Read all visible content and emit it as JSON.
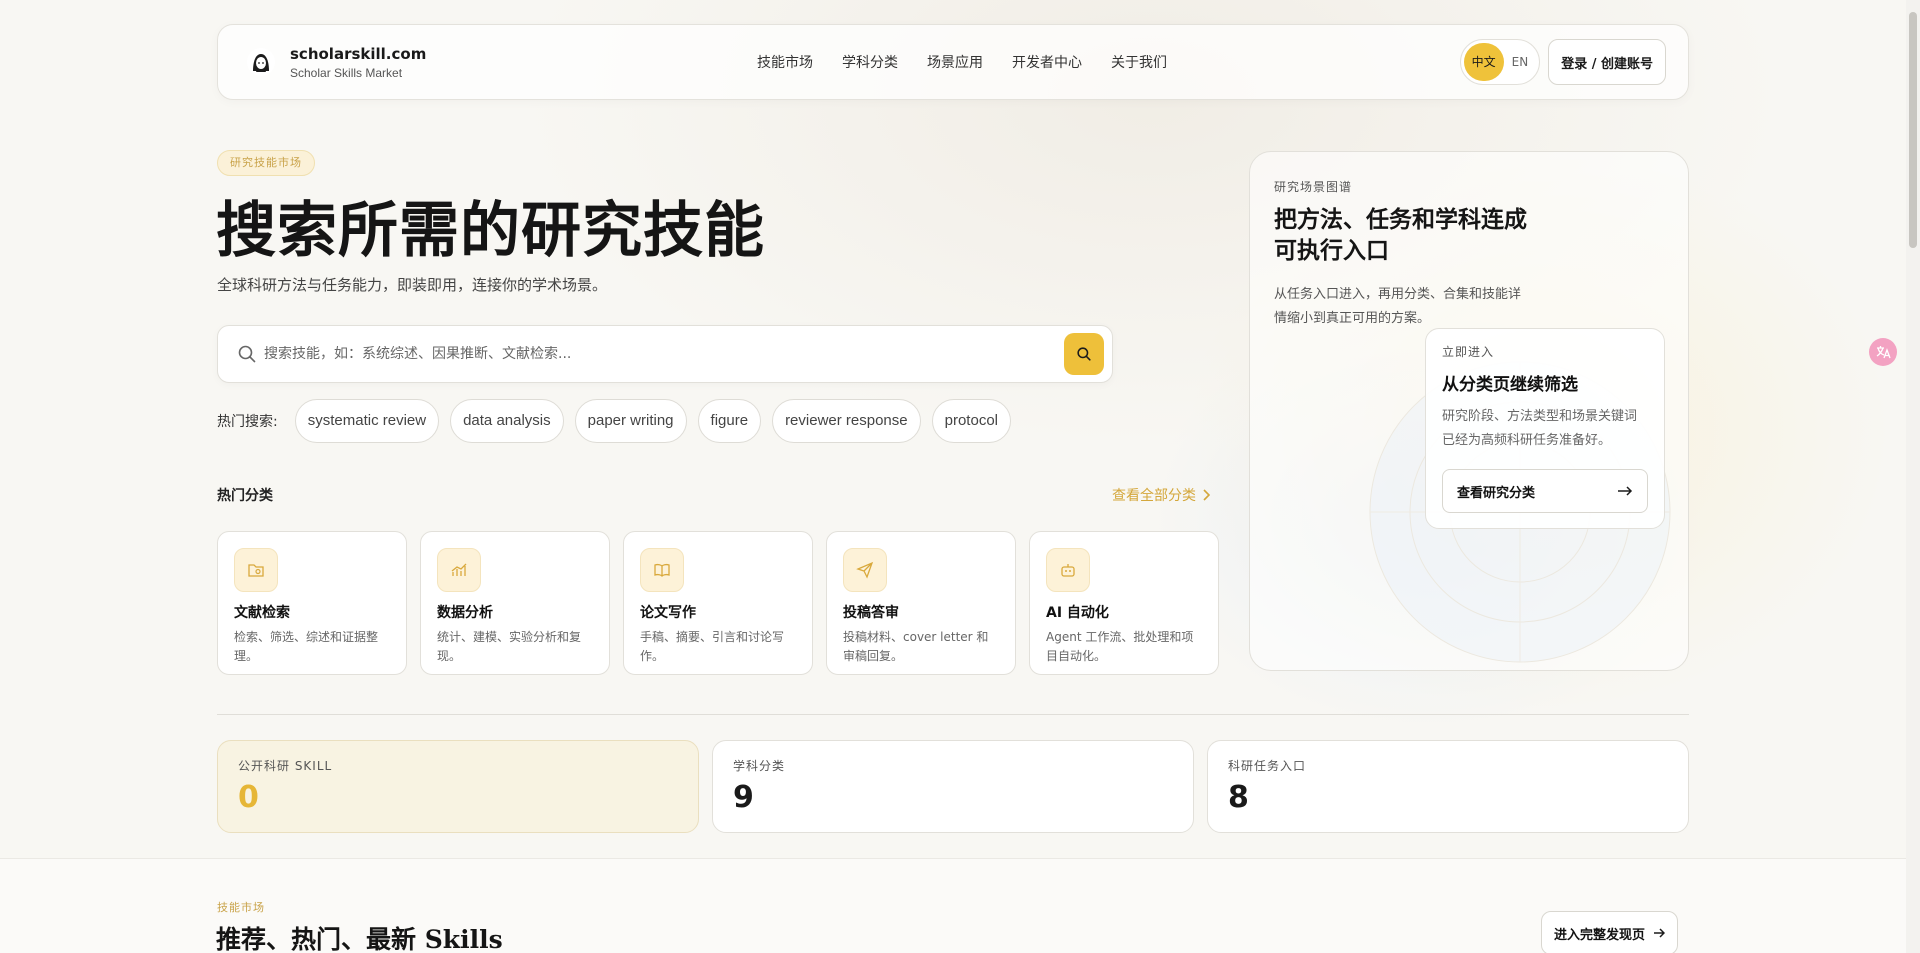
{
  "brand": {
    "name": "scholarskill.com",
    "subtitle": "Scholar Skills Market"
  },
  "nav": {
    "items": [
      "技能市场",
      "学科分类",
      "场景应用",
      "开发者中心",
      "关于我们"
    ]
  },
  "lang": {
    "zh": "中文",
    "en": "EN"
  },
  "header": {
    "login_label": "登录 / 创建账号"
  },
  "hero": {
    "pill": "研究技能市场",
    "title": "搜索所需的研究技能",
    "subtitle": "全球科研方法与任务能力，即装即用，连接你的学术场景。"
  },
  "search": {
    "placeholder": "搜索技能，如：系统综述、因果推断、文献检索..."
  },
  "hot": {
    "label": "热门搜索:",
    "tags": [
      "systematic review",
      "data analysis",
      "paper writing",
      "figure",
      "reviewer response",
      "protocol"
    ]
  },
  "categories": {
    "section_label": "热门分类",
    "see_all": "查看全部分类",
    "items": [
      {
        "title": "文献检索",
        "desc": "检索、筛选、综述和证据整理。"
      },
      {
        "title": "数据分析",
        "desc": "统计、建模、实验分析和复现。"
      },
      {
        "title": "论文写作",
        "desc": "手稿、摘要、引言和讨论写作。"
      },
      {
        "title": "投稿答审",
        "desc": "投稿材料、cover letter 和审稿回复。"
      },
      {
        "title": "AI 自动化",
        "desc": "Agent 工作流、批处理和项目自动化。"
      }
    ]
  },
  "panel": {
    "tag": "研究场景图谱",
    "title": "把方法、任务和学科连成可执行入口",
    "desc": "从任务入口进入，再用分类、合集和技能详情缩小到真正可用的方案。",
    "sub": {
      "tag": "立即进入",
      "title": "从分类页继续筛选",
      "desc": "研究阶段、方法类型和场景关键词已经为高频科研任务准备好。",
      "button": "查看研究分类"
    }
  },
  "stats": [
    {
      "label": "公开科研 SKILL",
      "value": "0"
    },
    {
      "label": "学科分类",
      "value": "9"
    },
    {
      "label": "科研任务入口",
      "value": "8"
    }
  ],
  "market": {
    "tag": "技能市场",
    "title": "推荐、热门、最新 Skills",
    "button": "进入完整发现页"
  },
  "colors": {
    "accent": "#eec03a",
    "accent_text": "#d4a73b"
  }
}
